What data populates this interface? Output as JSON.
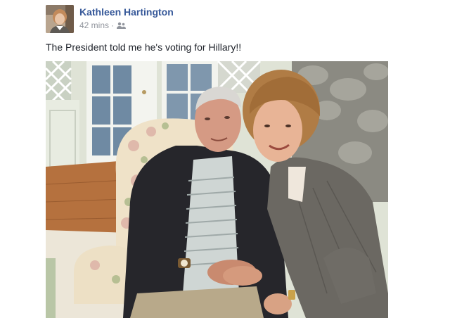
{
  "post": {
    "author_name": "Kathleen Hartington",
    "timestamp": "42 mins",
    "separator": "·",
    "audience_icon": "friends-icon",
    "text": "The President told me he's voting for Hillary!!",
    "photo_icon": "shared-photo"
  }
}
